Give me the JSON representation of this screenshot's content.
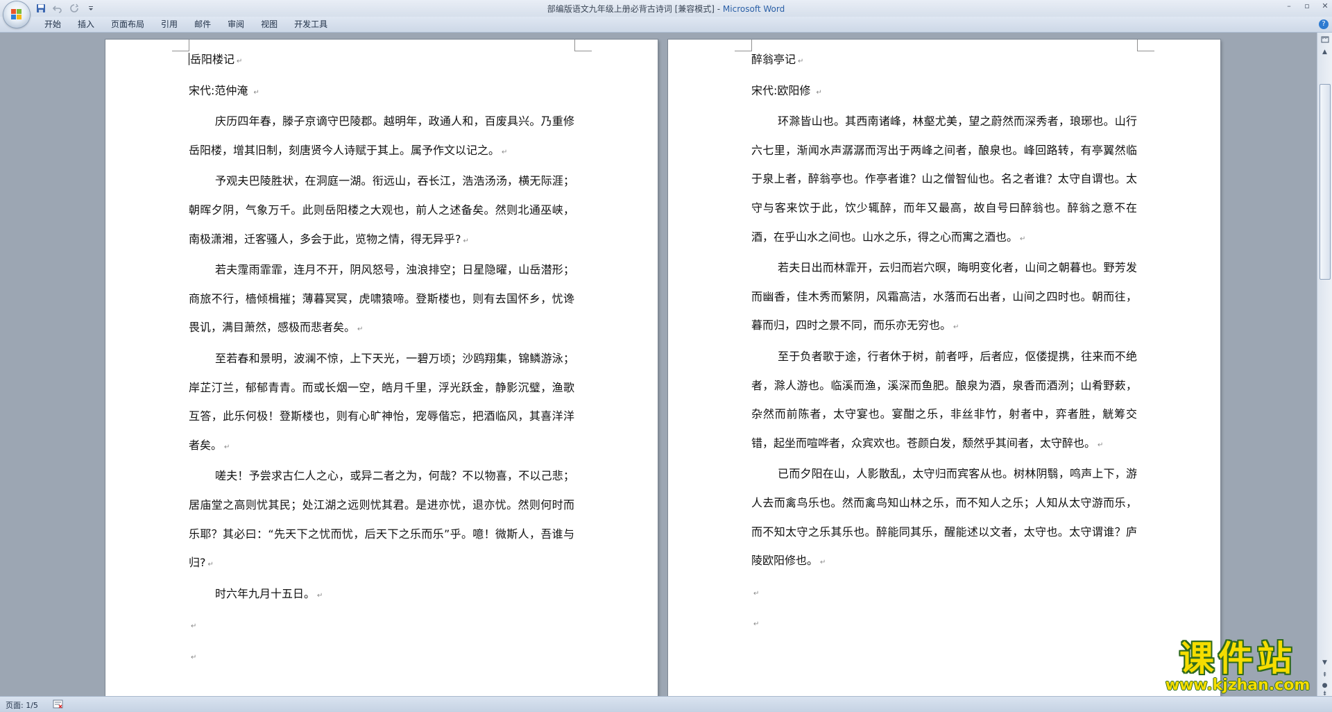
{
  "window": {
    "title": "部编版语文九年级上册必背古诗词 [兼容模式] - ",
    "app_name": "Microsoft Word"
  },
  "quick_access": {
    "save_icon": "save-icon",
    "undo_icon": "undo-icon",
    "redo_icon": "redo-icon",
    "customize_icon": "dropdown-arrow-icon"
  },
  "window_controls": {
    "minimize": "–",
    "restore": "▫",
    "close": "✕"
  },
  "ribbon": {
    "tabs": [
      "开始",
      "插入",
      "页面布局",
      "引用",
      "邮件",
      "审阅",
      "视图",
      "开发工具"
    ],
    "help": "?"
  },
  "page1": {
    "title": "岳阳楼记",
    "author": "宋代:范仲淹",
    "paragraphs": [
      "庆历四年春，滕子京谪守巴陵郡。越明年，政通人和，百废具兴。乃重修岳阳楼，增其旧制，刻唐贤今人诗赋于其上。属予作文以记之。",
      "予观夫巴陵胜状，在洞庭一湖。衔远山，吞长江，浩浩汤汤，横无际涯；朝晖夕阴，气象万千。此则岳阳楼之大观也，前人之述备矣。然则北通巫峡，南极潇湘，迁客骚人，多会于此，览物之情，得无异乎?",
      "若夫霪雨霏霏，连月不开，阴风怒号，浊浪排空；日星隐曜，山岳潜形；商旅不行，樯倾楫摧；薄暮冥冥，虎啸猿啼。登斯楼也，则有去国怀乡，忧谗畏讥，满目萧然，感极而悲者矣。",
      "至若春和景明，波澜不惊，上下天光，一碧万顷；沙鸥翔集，锦鳞游泳；岸芷汀兰，郁郁青青。而或长烟一空，皓月千里，浮光跃金，静影沉璧，渔歌互答，此乐何极！登斯楼也，则有心旷神怡，宠辱偕忘，把酒临风，其喜洋洋者矣。",
      "嗟夫！予尝求古仁人之心，或异二者之为，何哉？不以物喜，不以己悲；居庙堂之高则忧其民；处江湖之远则忧其君。是进亦忧，退亦忧。然则何时而乐耶？其必曰：“先天下之忧而忧，后天下之乐而乐”乎。噫！微斯人，吾谁与归?",
      "时六年九月十五日。"
    ]
  },
  "page2": {
    "title": "醉翁亭记",
    "author": "宋代:欧阳修",
    "paragraphs": [
      "环滁皆山也。其西南诸峰，林壑尤美，望之蔚然而深秀者，琅琊也。山行六七里，渐闻水声潺潺而泻出于两峰之间者，酿泉也。峰回路转，有亭翼然临于泉上者，醉翁亭也。作亭者谁？山之僧智仙也。名之者谁？太守自谓也。太守与客来饮于此，饮少辄醉，而年又最高，故自号曰醉翁也。醉翁之意不在酒，在乎山水之间也。山水之乐，得之心而寓之酒也。",
      "若夫日出而林霏开，云归而岩穴暝，晦明变化者，山间之朝暮也。野芳发而幽香，佳木秀而繁阴，风霜高洁，水落而石出者，山间之四时也。朝而往，暮而归，四时之景不同，而乐亦无穷也。",
      "至于负者歌于途，行者休于树，前者呼，后者应，伛偻提携，往来而不绝者，滁人游也。临溪而渔，溪深而鱼肥。酿泉为酒，泉香而酒洌；山肴野蔌，杂然而前陈者，太守宴也。宴酣之乐，非丝非竹，射者中，弈者胜，觥筹交错，起坐而喧哗者，众宾欢也。苍颜白发，颓然乎其间者，太守醉也。",
      "已而夕阳在山，人影散乱，太守归而宾客从也。树林阴翳，鸣声上下，游人去而禽鸟乐也。然而禽鸟知山林之乐，而不知人之乐；人知从太守游而乐，而不知太守之乐其乐也。醉能同其乐，醒能述以文者，太守也。太守谓谁？庐陵欧阳修也。"
    ]
  },
  "paragraph_mark": "↵",
  "status": {
    "page_info": "页面: 1/5"
  },
  "watermark": {
    "text": "课件站",
    "url": "www.kjzhan.com"
  },
  "colors": {
    "accent": "#2a5fa6",
    "watermark_yellow": "#f5dd00",
    "watermark_green": "#2f6a1e"
  }
}
